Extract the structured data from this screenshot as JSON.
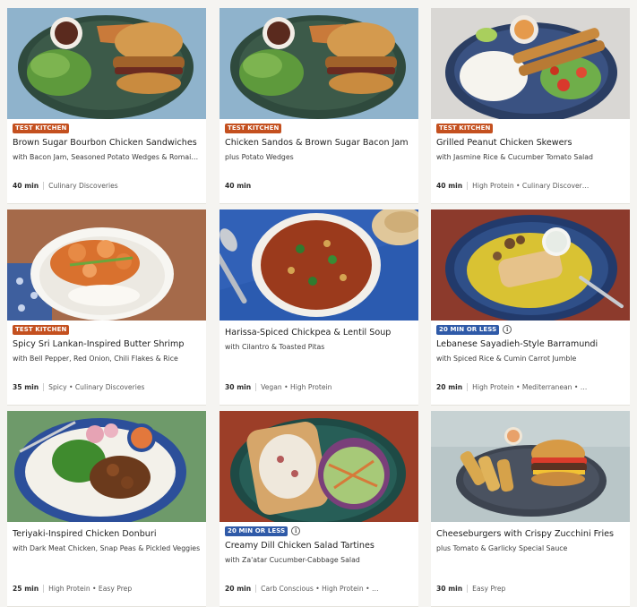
{
  "recipes": [
    {
      "badge": "Test Kitchen",
      "title": "Brown Sugar Bourbon Chicken Sandwiches",
      "subtitle": "with Bacon Jam, Seasoned Potato Wedges & Romaine Salad",
      "time": "40 min",
      "tags": "Culinary Discoveries",
      "image": "burger-plate-image"
    },
    {
      "badge": "Test Kitchen",
      "title": "Chicken Sandos & Brown Sugar Bacon Jam",
      "subtitle": "plus Potato Wedges",
      "time": "40 min",
      "tags": "",
      "image": "burger-plate-image"
    },
    {
      "badge": "Test Kitchen",
      "title": "Grilled Peanut Chicken Skewers",
      "subtitle": "with Jasmine Rice & Cucumber Tomato Salad",
      "time": "40 min",
      "tags": "High Protein • Culinary Discover…",
      "image": "skewers-plate-image"
    },
    {
      "badge": "Test Kitchen",
      "title": "Spicy Sri Lankan-Inspired Butter Shrimp",
      "subtitle": "with Bell Pepper, Red Onion, Chili Flakes & Rice",
      "time": "35 min",
      "tags": "Spicy • Culinary Discoveries",
      "image": "shrimp-bowl-image"
    },
    {
      "badge": "",
      "title": "Harissa-Spiced Chickpea & Lentil Soup",
      "subtitle": "with Cilantro & Toasted Pitas",
      "time": "30 min",
      "tags": "Vegan • High Protein",
      "image": "soup-bowl-image"
    },
    {
      "badge": "20 min or less",
      "title": "Lebanese Sayadieh-Style Barramundi",
      "subtitle": "with Spiced Rice & Cumin Carrot Jumble",
      "time": "20 min",
      "tags": "High Protein • Mediterranean • …",
      "image": "fish-rice-image"
    },
    {
      "badge": "",
      "title": "Teriyaki-Inspired Chicken Donburi",
      "subtitle": "with Dark Meat Chicken, Snap Peas & Pickled Veggies",
      "time": "25 min",
      "tags": "High Protein • Easy Prep",
      "image": "donburi-bowl-image"
    },
    {
      "badge": "20 min or less",
      "title": "Creamy Dill Chicken Salad Tartines",
      "subtitle": "with Za'atar Cucumber-Cabbage Salad",
      "time": "20 min",
      "tags": "Carb Conscious • High Protein • …",
      "image": "tartine-plate-image"
    },
    {
      "badge": "",
      "title": "Cheeseburgers with Crispy Zucchini Fries",
      "subtitle": "plus Tomato & Garlicky Special Sauce",
      "time": "30 min",
      "tags": "Easy Prep",
      "image": "cheeseburger-plate-image"
    }
  ],
  "colors": {
    "test_kitchen_badge": "#c4501f",
    "quick_badge": "#2f5aa8",
    "page_background": "#f5f4f1"
  }
}
